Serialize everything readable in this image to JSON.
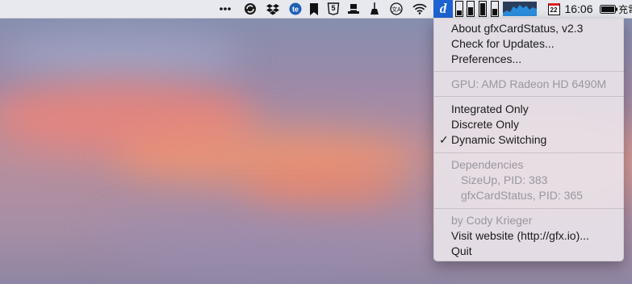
{
  "menubar": {
    "clock": "16:06",
    "calendar_day": "22",
    "input_method": "充電",
    "active_app_letter": "d",
    "badge_text": "5",
    "icons": [
      "more-icon",
      "sync-icon",
      "dropbox-icon",
      "te-icon",
      "bookmark-icon",
      "html5-icon",
      "wizard-hat-icon",
      "broom-icon",
      "translate-icon",
      "wifi-icon",
      "gfxcardstatus-icon",
      "memory-icon",
      "cpu-icon",
      "cpu-graph-icon",
      "calendar-icon"
    ]
  },
  "menu": {
    "about": "About gfxCardStatus, v2.3",
    "check_updates": "Check for Updates...",
    "preferences": "Preferences...",
    "gpu": "GPU: AMD Radeon HD 6490M",
    "integrated": "Integrated Only",
    "discrete": "Discrete Only",
    "dynamic": "Dynamic Switching",
    "checkmark": "✓",
    "dependencies": "Dependencies",
    "dep1": "SizeUp, PID: 383",
    "dep2": "gfxCardStatus, PID: 365",
    "author": "by Cody Krieger",
    "website": "Visit website (http://gfx.io)...",
    "quit": "Quit"
  }
}
